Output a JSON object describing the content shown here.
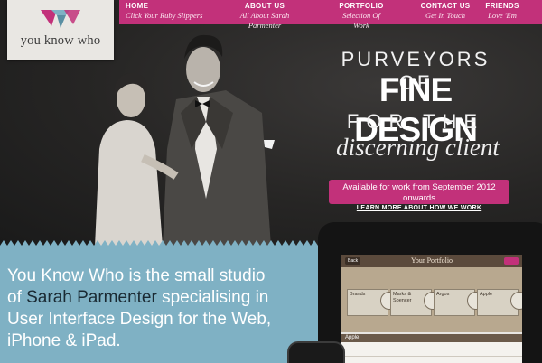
{
  "logo": {
    "text": "you know who"
  },
  "nav": [
    {
      "title": "HOME",
      "subtitle": "Click Your Ruby Slippers"
    },
    {
      "title": "ABOUT US",
      "subtitle": "All About Sarah Parmenter"
    },
    {
      "title": "PORTFOLIO",
      "subtitle": "Selection Of Work"
    },
    {
      "title": "CONTACT US",
      "subtitle": "Get In Touch"
    },
    {
      "title": "FRIENDS",
      "subtitle": "Love 'Em"
    }
  ],
  "hero": {
    "line1": "PURVEYORS OF",
    "line2": "FINE DESIGN",
    "line3": "FOR THE",
    "line4": "discerning client",
    "availability": "Available for work from September 2012 onwards",
    "learn_more": "LEARN MORE ABOUT HOW WE WORK"
  },
  "intro": {
    "before": "You Know Who is the small studio of ",
    "name": "Sarah Parmenter",
    "after": " specialising in User Interface Design for the Web, iPhone & iPad."
  },
  "ipad": {
    "title": "Your Portfolio",
    "left_button": "Back",
    "tiles": [
      "Brands",
      "Marks & Spencer",
      "Argos",
      "Apple"
    ],
    "list_header": "Apple"
  },
  "colors": {
    "accent": "#c2317a",
    "blue": "#7fb1c4",
    "dark": "#262524"
  }
}
